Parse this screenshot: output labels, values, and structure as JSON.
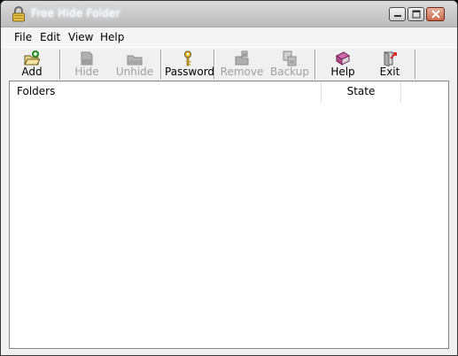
{
  "window": {
    "title": "Free Hide Folder",
    "controls": {
      "minimize": "minimize-icon",
      "maximize": "maximize-icon",
      "close": "close-icon"
    }
  },
  "menu": {
    "file": "File",
    "edit": "Edit",
    "view": "View",
    "help": "Help"
  },
  "toolbar": {
    "add": {
      "label": "Add",
      "icon": "add-folder-icon",
      "enabled": true
    },
    "hide": {
      "label": "Hide",
      "icon": "hide-folder-icon",
      "enabled": false
    },
    "unhide": {
      "label": "Unhide",
      "icon": "unhide-folder-icon",
      "enabled": false
    },
    "password": {
      "label": "Password",
      "icon": "key-icon",
      "enabled": true
    },
    "remove": {
      "label": "Remove",
      "icon": "remove-icon",
      "enabled": false
    },
    "backup": {
      "label": "Backup",
      "icon": "backup-icon",
      "enabled": false
    },
    "help": {
      "label": "Help",
      "icon": "help-book-icon",
      "enabled": true
    },
    "exit": {
      "label": "Exit",
      "icon": "exit-icon",
      "enabled": true
    }
  },
  "list": {
    "columns": [
      "Folders",
      "State"
    ],
    "rows": []
  },
  "colors": {
    "titlebar": "#c9c9c9",
    "close_button": "#c86a4b",
    "disabled_text": "#a0a0a0",
    "list_background": "#ffffff"
  }
}
